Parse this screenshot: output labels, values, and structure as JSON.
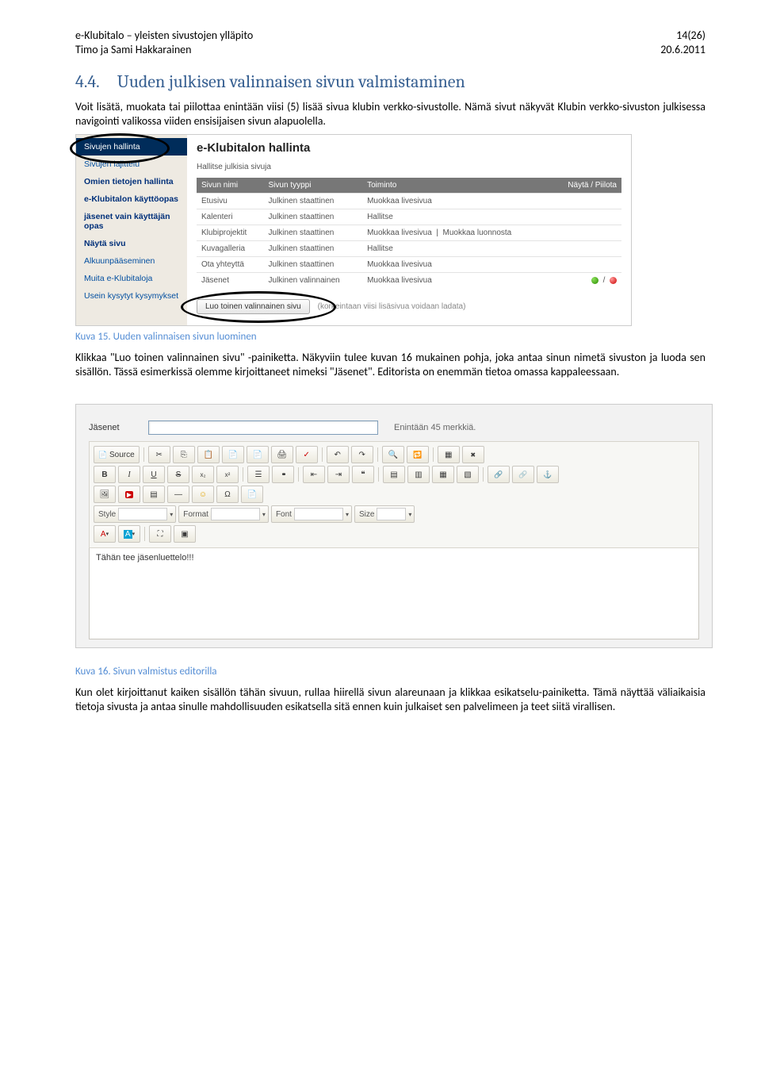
{
  "header": {
    "left1": "e-Klubitalo – yleisten sivustojen ylläpito",
    "left2": "Timo ja Sami Hakkarainen",
    "right1": "14(26)",
    "right2": "20.6.2011"
  },
  "section": {
    "num": "4.4.",
    "title": "Uuden julkisen valinnaisen sivun valmistaminen"
  },
  "para1": "Voit lisätä, muokata tai piilottaa enintään viisi (5) lisää sivua klubin verkko-sivustolle. Nämä sivut näkyvät Klubin verkko-sivuston julkisessa navigointi valikossa viiden ensisijaisen sivun alapuolella.",
  "fig1": {
    "caption": "Kuva 15. Uuden valinnaisen sivun luominen"
  },
  "para2a": "Klikkaa \"Luo toinen valinnainen sivu\" -painiketta. Näkyviin tulee kuvan 16 mukainen pohja, joka antaa sinun nimetä sivuston ja luoda sen sisällön. Tässä esimerkissä olemme kirjoittaneet nimeksi \"Jäsenet\". Editorista on enemmän tietoa omassa kappaleessaan.",
  "fig2": {
    "caption": "Kuva 16. Sivun valmistus editorilla"
  },
  "para3": "Kun olet kirjoittanut kaiken sisällön tähän sivuun, rullaa hiirellä sivun alareunaan ja klikkaa esikatselu-painiketta. Tämä näyttää väliaikaisia tietoja sivusta ja antaa sinulle mahdollisuuden esikatsella sitä ennen kuin julkaiset sen palvelimeen ja teet siitä virallisen.",
  "shot1": {
    "side": {
      "items_top": [],
      "highlight": "Sivujen hallinta",
      "items": [
        "Sivujen lajittelu",
        "Omien tietojen hallinta",
        "e-Klubitalon käyttöopas",
        "jäsenet vain käyttäjän opas",
        "Näytä sivu",
        "Alkuunpääseminen",
        "Muita e-Klubitaloja",
        "Usein kysytyt kysymykset"
      ]
    },
    "title": "e-Klubitalon hallinta",
    "subtitle": "Hallitse julkisia sivuja",
    "cols": {
      "c1": "Sivun nimi",
      "c2": "Sivun tyyppi",
      "c3": "Toiminto",
      "c4": "Näytä / Piilota"
    },
    "rows": [
      {
        "name": "Etusivu",
        "type": "Julkinen staattinen",
        "act1": "Muokkaa livesivua",
        "act2": "",
        "dots": false
      },
      {
        "name": "Kalenteri",
        "type": "Julkinen staattinen",
        "act1": "Hallitse",
        "act2": "",
        "dots": false
      },
      {
        "name": "Klubiprojektit",
        "type": "Julkinen staattinen",
        "act1": "Muokkaa livesivua",
        "act2": "Muokkaa luonnosta",
        "dots": false
      },
      {
        "name": "Kuvagalleria",
        "type": "Julkinen staattinen",
        "act1": "Hallitse",
        "act2": "",
        "dots": false
      },
      {
        "name": "Ota yhteyttä",
        "type": "Julkinen staattinen",
        "act1": "Muokkaa livesivua",
        "act2": "",
        "dots": false
      },
      {
        "name": "Jäsenet",
        "type": "Julkinen valinnainen",
        "act1": "Muokkaa livesivua",
        "act2": "",
        "dots": true
      }
    ],
    "button": "Luo toinen valinnainen sivu",
    "hint": "(korkeintaan viisi lisäsivua voidaan ladata)"
  },
  "shot2": {
    "name_label": "Jäsenet",
    "hint": "Enintään 45 merkkiä.",
    "source_btn": "Source",
    "combos": {
      "style": "Style",
      "format": "Format",
      "font": "Font",
      "size": "Size"
    },
    "editor_text": "Tähän tee jäsenluettelo!!!"
  }
}
